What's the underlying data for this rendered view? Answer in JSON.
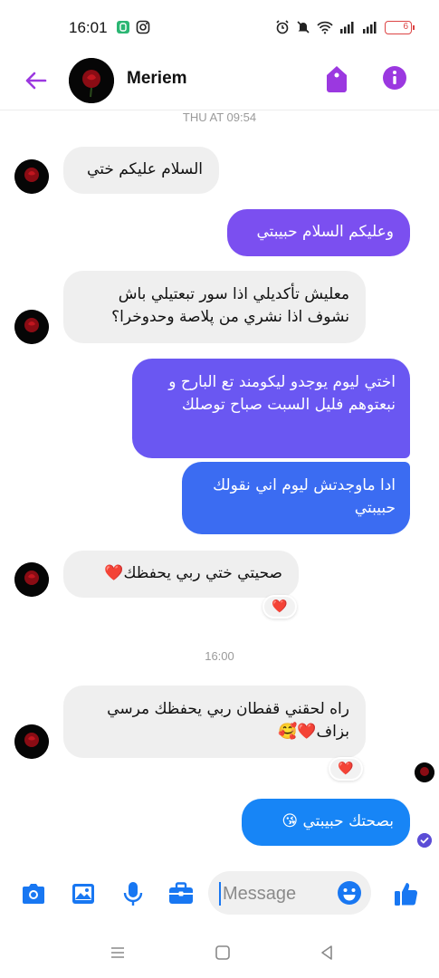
{
  "status_bar": {
    "time": "16:01",
    "battery": "6",
    "icons": [
      "whatsapp-icon",
      "instagram-icon",
      "alarm-icon",
      "mute-icon",
      "wifi-icon",
      "signal-icon",
      "signal-icon",
      "battery-icon"
    ]
  },
  "header": {
    "contact_name": "Meriem",
    "icons": [
      "back-arrow-icon",
      "tag-icon",
      "info-icon"
    ],
    "accent_color": "#9b38e0"
  },
  "timestamps": {
    "first": "THU AT 09:54",
    "second": "16:00"
  },
  "messages": [
    {
      "from": "them",
      "text": "السلام عليكم ختي"
    },
    {
      "from": "me",
      "text": "وعليكم السلام حبيبتي"
    },
    {
      "from": "them",
      "text": "معليش تأكديلي اذا سور تبعتيلي باش نشوف اذا نشري من پلاصة وحدوخرا؟"
    },
    {
      "from": "me",
      "text": "اختي ليوم يوجدو ليكومند تع البارح و نبعتوهم فليل السبت صباح توصلك"
    },
    {
      "from": "me",
      "text": "ادا ماوجدتش ليوم اني نقولك حبيبتي"
    },
    {
      "from": "them",
      "text": "صحيتي ختي ربي يحفظك❤️",
      "reaction": "❤️"
    },
    {
      "from": "them",
      "text": "راه لحقني قفطان ربي يحفظك مرسي بزاف❤️🥰",
      "reaction": "❤️"
    },
    {
      "from": "me",
      "text": "بصحتك حبيبتي 😘"
    }
  ],
  "composer": {
    "placeholder": "Message",
    "icons": [
      "camera-icon",
      "image-icon",
      "microphone-icon",
      "briefcase-icon",
      "emoji-icon",
      "thumbs-up-icon"
    ],
    "icon_color": "#1877f2"
  },
  "navbar": {
    "icons": [
      "menu-icon",
      "home-icon",
      "back-icon"
    ]
  }
}
